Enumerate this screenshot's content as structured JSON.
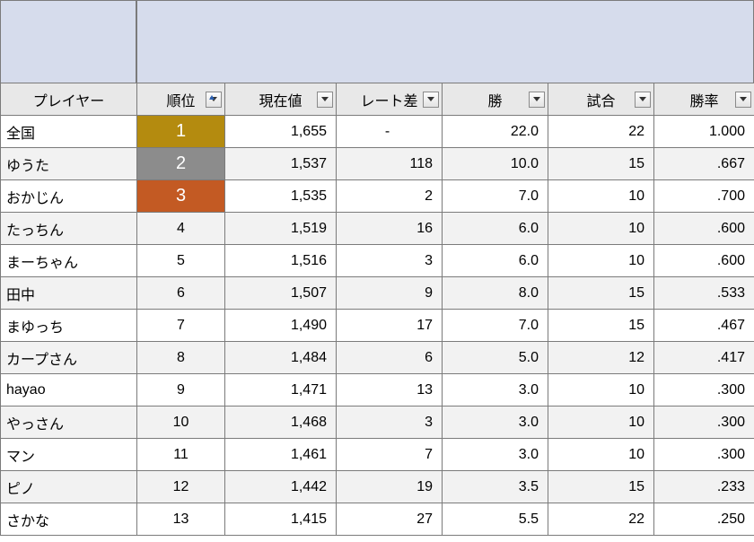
{
  "headers": {
    "player": "プレイヤー",
    "rank": "順位",
    "value": "現在値",
    "diff": "レート差",
    "wins": "勝",
    "games": "試合",
    "rate": "勝率"
  },
  "chart_data": {
    "type": "table",
    "title": "",
    "columns": [
      "プレイヤー",
      "順位",
      "現在値",
      "レート差",
      "勝",
      "試合",
      "勝率"
    ],
    "rows": [
      {
        "player": "全国",
        "rank": 1,
        "value": 1655,
        "diff": null,
        "wins": 22.0,
        "games": 22,
        "rate": 1.0
      },
      {
        "player": "ゆうた",
        "rank": 2,
        "value": 1537,
        "diff": 118,
        "wins": 10.0,
        "games": 15,
        "rate": 0.667
      },
      {
        "player": "おかじん",
        "rank": 3,
        "value": 1535,
        "diff": 2,
        "wins": 7.0,
        "games": 10,
        "rate": 0.7
      },
      {
        "player": "たっちん",
        "rank": 4,
        "value": 1519,
        "diff": 16,
        "wins": 6.0,
        "games": 10,
        "rate": 0.6
      },
      {
        "player": "まーちゃん",
        "rank": 5,
        "value": 1516,
        "diff": 3,
        "wins": 6.0,
        "games": 10,
        "rate": 0.6
      },
      {
        "player": "田中",
        "rank": 6,
        "value": 1507,
        "diff": 9,
        "wins": 8.0,
        "games": 15,
        "rate": 0.533
      },
      {
        "player": "まゆっち",
        "rank": 7,
        "value": 1490,
        "diff": 17,
        "wins": 7.0,
        "games": 15,
        "rate": 0.467
      },
      {
        "player": "カープさん",
        "rank": 8,
        "value": 1484,
        "diff": 6,
        "wins": 5.0,
        "games": 12,
        "rate": 0.417
      },
      {
        "player": "hayao",
        "rank": 9,
        "value": 1471,
        "diff": 13,
        "wins": 3.0,
        "games": 10,
        "rate": 0.3
      },
      {
        "player": "やっさん",
        "rank": 10,
        "value": 1468,
        "diff": 3,
        "wins": 3.0,
        "games": 10,
        "rate": 0.3
      },
      {
        "player": "マン",
        "rank": 11,
        "value": 1461,
        "diff": 7,
        "wins": 3.0,
        "games": 10,
        "rate": 0.3
      },
      {
        "player": "ピノ",
        "rank": 12,
        "value": 1442,
        "diff": 19,
        "wins": 3.5,
        "games": 15,
        "rate": 0.233
      },
      {
        "player": "さかな",
        "rank": 13,
        "value": 1415,
        "diff": 27,
        "wins": 5.5,
        "games": 22,
        "rate": 0.25
      }
    ]
  }
}
